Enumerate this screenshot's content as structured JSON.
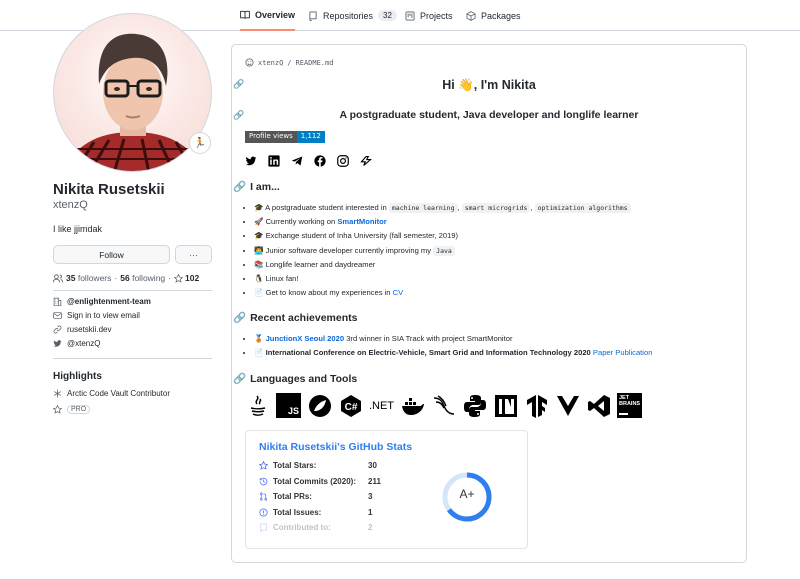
{
  "tabs": [
    {
      "label": "Overview",
      "icon": "book-icon"
    },
    {
      "label": "Repositories",
      "icon": "repo-icon",
      "count": "32"
    },
    {
      "label": "Projects",
      "icon": "project-icon"
    },
    {
      "label": "Packages",
      "icon": "package-icon"
    }
  ],
  "profile": {
    "name": "Nikita Rusetskii",
    "login": "xtenzQ",
    "bio": "I like jjimdak",
    "status_emoji": "🏃",
    "follow_label": "Follow",
    "more_label": "···",
    "followers_count": "35",
    "followers_label": "followers",
    "separator": "·",
    "following_count": "56",
    "following_label": "following",
    "stars_count": "102",
    "org": "@enlightenment-team",
    "email": "Sign in to view email",
    "website": "rusetskii.dev",
    "twitter": "@xtenzQ"
  },
  "highlights": {
    "title": "Highlights",
    "items": [
      "Arctic Code Vault Contributor",
      "PRO"
    ]
  },
  "readme": {
    "path_user": "xtenzQ",
    "path_sep": "/",
    "path_file": "README.md",
    "heading": "Hi 👋, I'm Nikita",
    "subheading": "A postgraduate student, Java developer and longlife learner",
    "badge_label": "Profile views",
    "badge_value": "1,112",
    "social": [
      "twitter-icon",
      "linkedin-icon",
      "telegram-icon",
      "facebook-icon",
      "instagram-icon",
      "gitlab-icon"
    ],
    "iam_title": "I am...",
    "iam": {
      "i1_pre": "A postgraduate student interested in",
      "i1_c1": "machine learning",
      "i1_c2": "smart microgrids",
      "i1_c3": "optimization algorithms",
      "i2_pre": "Currently working on",
      "i2_link": "SmartMonitor",
      "i3": "Exchange student of Inha University (fall semester, 2019)",
      "i4_pre": "Junior software developer currently improving my",
      "i4_code": "Java",
      "i5": "Longlife learner and daydreamer",
      "i6": "Linux fan!",
      "i7_pre": "Get to know about my experiences in",
      "i7_link": "CV"
    },
    "ach_title": "Recent achievements",
    "ach": {
      "a1_link": "JunctionX Seoul 2020",
      "a1_rest": "3rd winner in SIA Track with project SmartMonitor",
      "a2_bold": "International Conference on Electric-Vehicle, Smart Grid and Information Technology 2020",
      "a2_link": "Paper Publication"
    },
    "lang_title": "Languages and Tools",
    "langs": {
      "java": "java-icon",
      "js": "JS",
      "spring": "spring-icon",
      "csharp": "C#",
      "dotnet": ".NET",
      "docker": "docker-icon",
      "lisp": "lisp-icon",
      "python": "python-icon",
      "intellij": "intellij-icon",
      "tensorflow": "tensorflow-icon",
      "vue": "vue-icon",
      "vscode": "vscode-icon",
      "jetbrains_l1": "JET",
      "jetbrains_l2": "BRAINS"
    }
  },
  "stats": {
    "title": "Nikita Rusetskii's GitHub Stats",
    "rows": [
      {
        "label": "Total Stars:",
        "value": "30",
        "icon": "star-icon"
      },
      {
        "label": "Total Commits (2020):",
        "value": "211",
        "icon": "history-icon"
      },
      {
        "label": "Total PRs:",
        "value": "3",
        "icon": "pr-icon"
      },
      {
        "label": "Total Issues:",
        "value": "1",
        "icon": "issue-icon"
      },
      {
        "label": "Contributed to:",
        "value": "2",
        "icon": "repo-icon"
      }
    ],
    "grade": "A+",
    "accent": "#2f80ed"
  }
}
